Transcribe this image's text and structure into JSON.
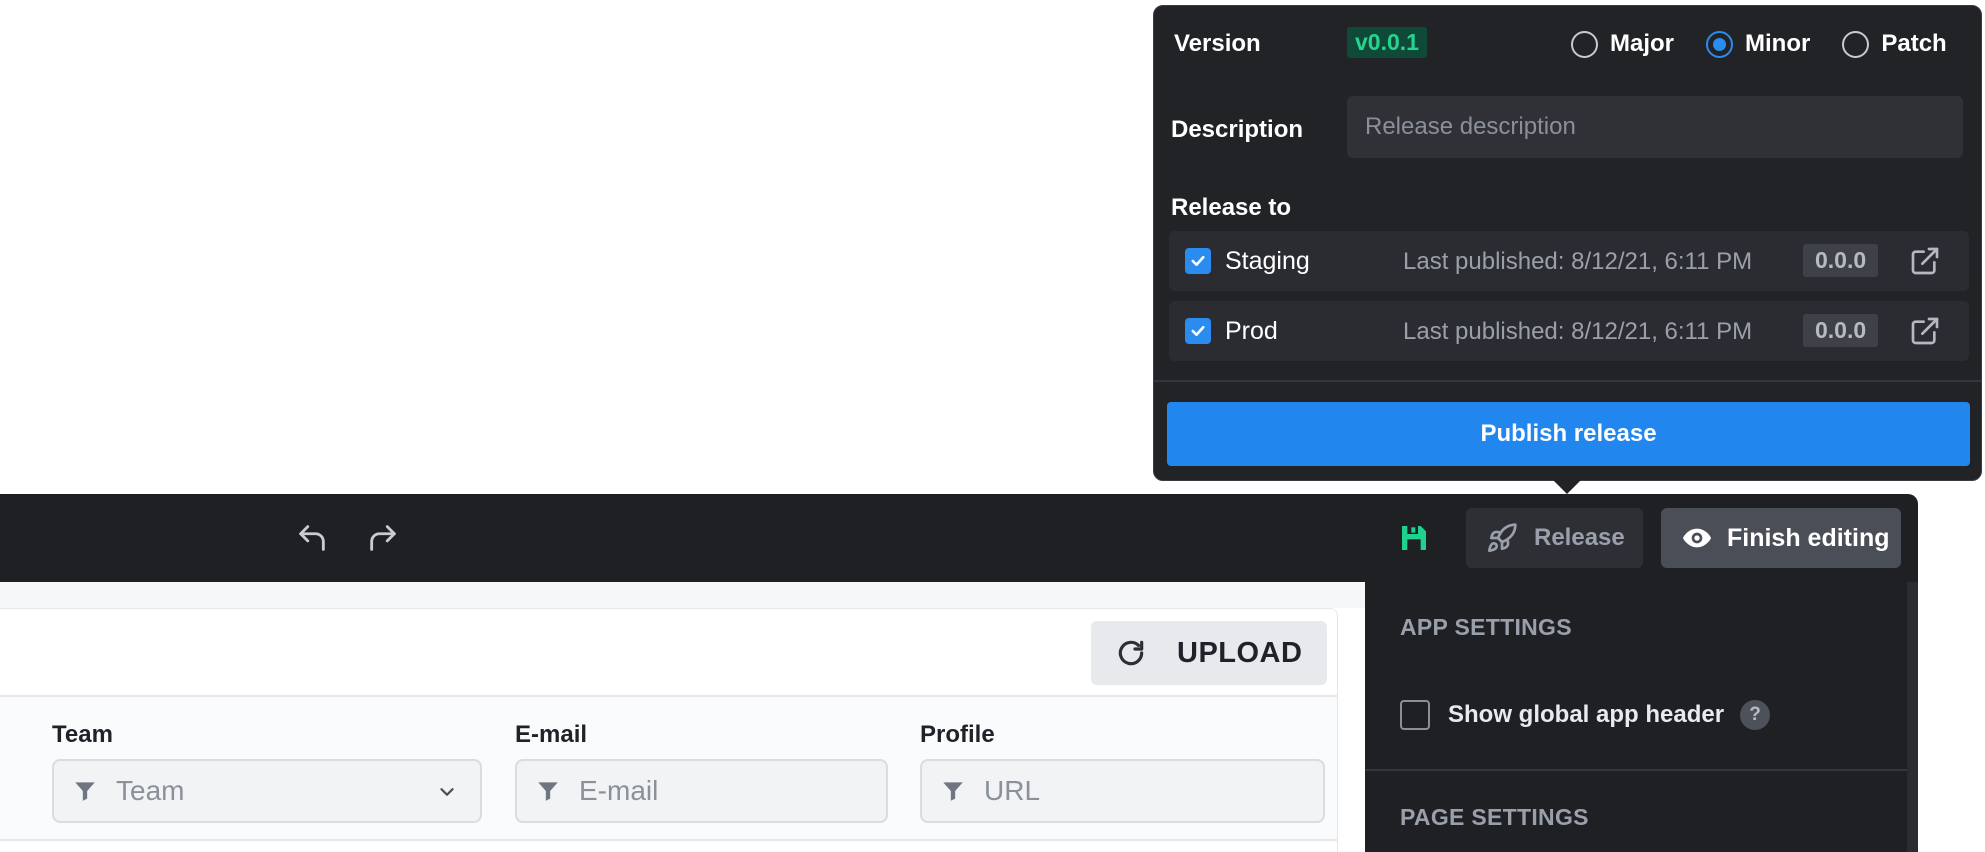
{
  "popover": {
    "version_label": "Version",
    "version_value": "v0.0.1",
    "bump_options": [
      {
        "label": "Major",
        "selected": false
      },
      {
        "label": "Minor",
        "selected": true
      },
      {
        "label": "Patch",
        "selected": false
      }
    ],
    "description_label": "Description",
    "description_placeholder": "Release description",
    "release_to_label": "Release to",
    "environments": [
      {
        "name": "Staging",
        "last_published": "Last published: 8/12/21, 6:11 PM",
        "version": "0.0.0",
        "checked": true
      },
      {
        "name": "Prod",
        "last_published": "Last published: 8/12/21, 6:11 PM",
        "version": "0.0.0",
        "checked": true
      }
    ],
    "publish_label": "Publish release"
  },
  "toolbar": {
    "icons": [
      "undo-icon",
      "redo-icon",
      "save-icon"
    ],
    "release_label": "Release",
    "finish_label": "Finish editing"
  },
  "content": {
    "upload_label": "UPLOAD",
    "filters": [
      {
        "label": "Team",
        "placeholder": "Team",
        "type": "select"
      },
      {
        "label": "E-mail",
        "placeholder": "E-mail",
        "type": "text"
      },
      {
        "label": "Profile",
        "placeholder": "URL",
        "type": "text"
      }
    ]
  },
  "settings": {
    "app_settings_title": "APP SETTINGS",
    "show_header_label": "Show global app header",
    "help_glyph": "?",
    "page_settings_title": "PAGE SETTINGS"
  },
  "colors": {
    "accent_blue": "#2186ee",
    "save_green": "#1fd18f",
    "version_green": "#24d48f"
  }
}
